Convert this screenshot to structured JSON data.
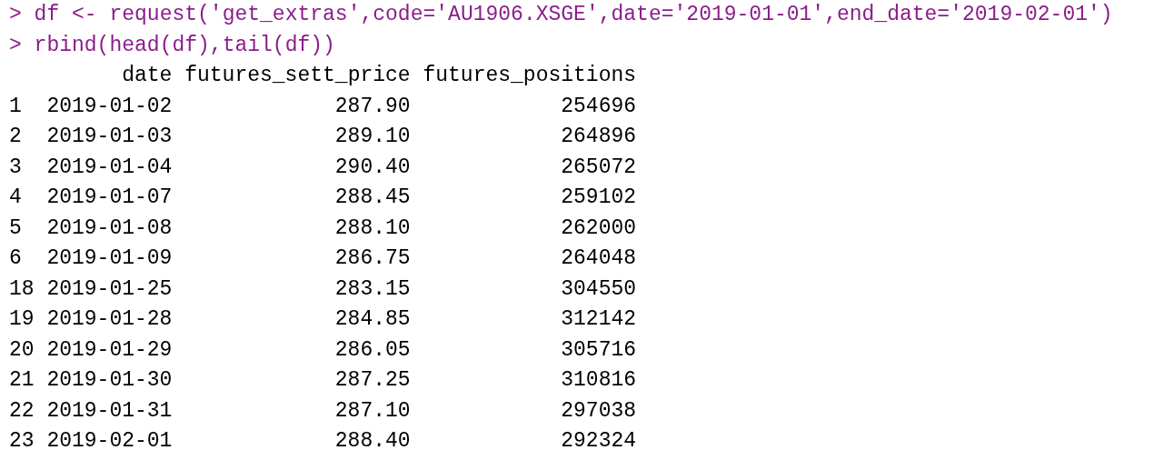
{
  "commands": [
    {
      "prompt": ">",
      "text": "df <- request('get_extras',code='AU1906.XSGE',date='2019-01-01',end_date='2019-02-01')"
    },
    {
      "prompt": ">",
      "text": "rbind(head(df),tail(df))"
    }
  ],
  "table": {
    "columns": [
      "date",
      "futures_sett_price",
      "futures_positions"
    ],
    "rows": [
      {
        "index": "1",
        "cells": [
          "2019-01-02",
          "287.90",
          "254696"
        ]
      },
      {
        "index": "2",
        "cells": [
          "2019-01-03",
          "289.10",
          "264896"
        ]
      },
      {
        "index": "3",
        "cells": [
          "2019-01-04",
          "290.40",
          "265072"
        ]
      },
      {
        "index": "4",
        "cells": [
          "2019-01-07",
          "288.45",
          "259102"
        ]
      },
      {
        "index": "5",
        "cells": [
          "2019-01-08",
          "288.10",
          "262000"
        ]
      },
      {
        "index": "6",
        "cells": [
          "2019-01-09",
          "286.75",
          "264048"
        ]
      },
      {
        "index": "18",
        "cells": [
          "2019-01-25",
          "283.15",
          "304550"
        ]
      },
      {
        "index": "19",
        "cells": [
          "2019-01-28",
          "284.85",
          "312142"
        ]
      },
      {
        "index": "20",
        "cells": [
          "2019-01-29",
          "286.05",
          "305716"
        ]
      },
      {
        "index": "21",
        "cells": [
          "2019-01-30",
          "287.25",
          "310816"
        ]
      },
      {
        "index": "22",
        "cells": [
          "2019-01-31",
          "287.10",
          "297038"
        ]
      },
      {
        "index": "23",
        "cells": [
          "2019-02-01",
          "288.40",
          "292324"
        ]
      }
    ]
  }
}
